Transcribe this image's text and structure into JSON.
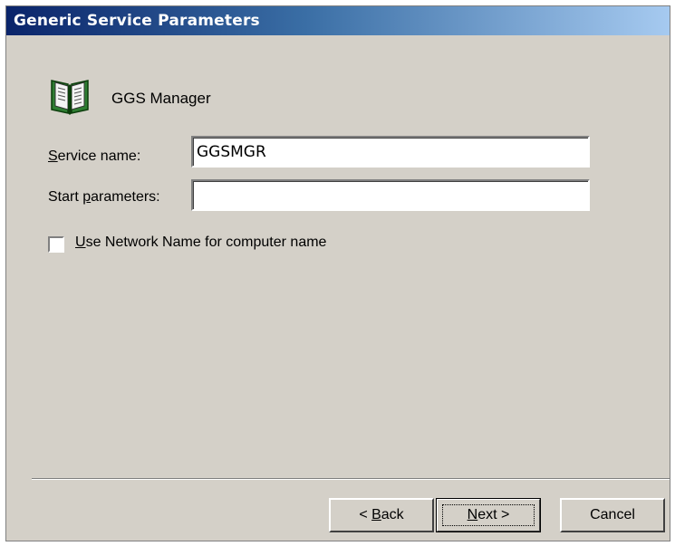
{
  "dialog": {
    "title": "Generic Service Parameters"
  },
  "header": {
    "icon": "open-book-icon",
    "label": "GGS Manager"
  },
  "fields": {
    "service_name": {
      "label_mnemonic": "S",
      "label_rest": "ervice name:",
      "value": "GGSMGR"
    },
    "start_parameters": {
      "label_pre": "Start ",
      "label_mnemonic": "p",
      "label_rest": "arameters:",
      "value": ""
    }
  },
  "options": {
    "use_network_name": {
      "label_mnemonic": "U",
      "label_rest": "se Network Name for computer name",
      "checked": false
    }
  },
  "buttons": {
    "back": {
      "prefix": "< ",
      "mnemonic": "B",
      "rest": "ack"
    },
    "next": {
      "mnemonic": "N",
      "rest": "ext >"
    },
    "cancel": {
      "label": "Cancel"
    }
  }
}
